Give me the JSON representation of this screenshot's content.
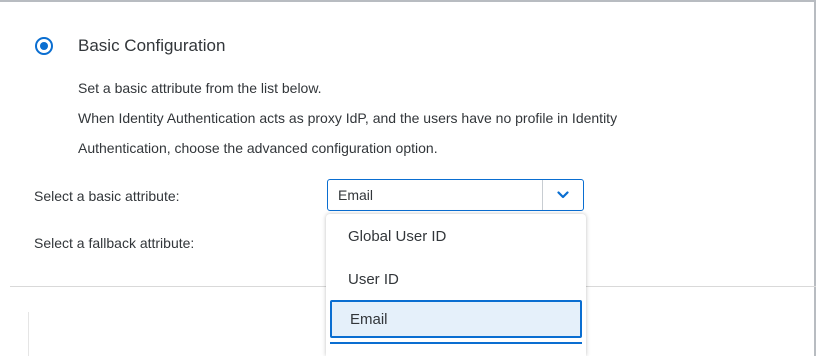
{
  "radio": {
    "label": "Basic Configuration",
    "selected": true
  },
  "description": {
    "line1": "Set a basic attribute from the list below.",
    "line2": "When Identity Authentication acts as proxy IdP, and the users have no profile in Identity",
    "line3": "Authentication, choose the advanced configuration option."
  },
  "basic_attribute": {
    "label": "Select a basic attribute:",
    "value": "Email",
    "options": [
      "Global User ID",
      "User ID",
      "Email"
    ],
    "highlighted": "Email"
  },
  "fallback_attribute": {
    "label": "Select a fallback attribute:"
  },
  "colors": {
    "accent": "#0a6ed1",
    "highlight_bg": "#e5f0fa",
    "text": "#32363a"
  },
  "icons": {
    "dropdown": "chevron-down-icon"
  }
}
